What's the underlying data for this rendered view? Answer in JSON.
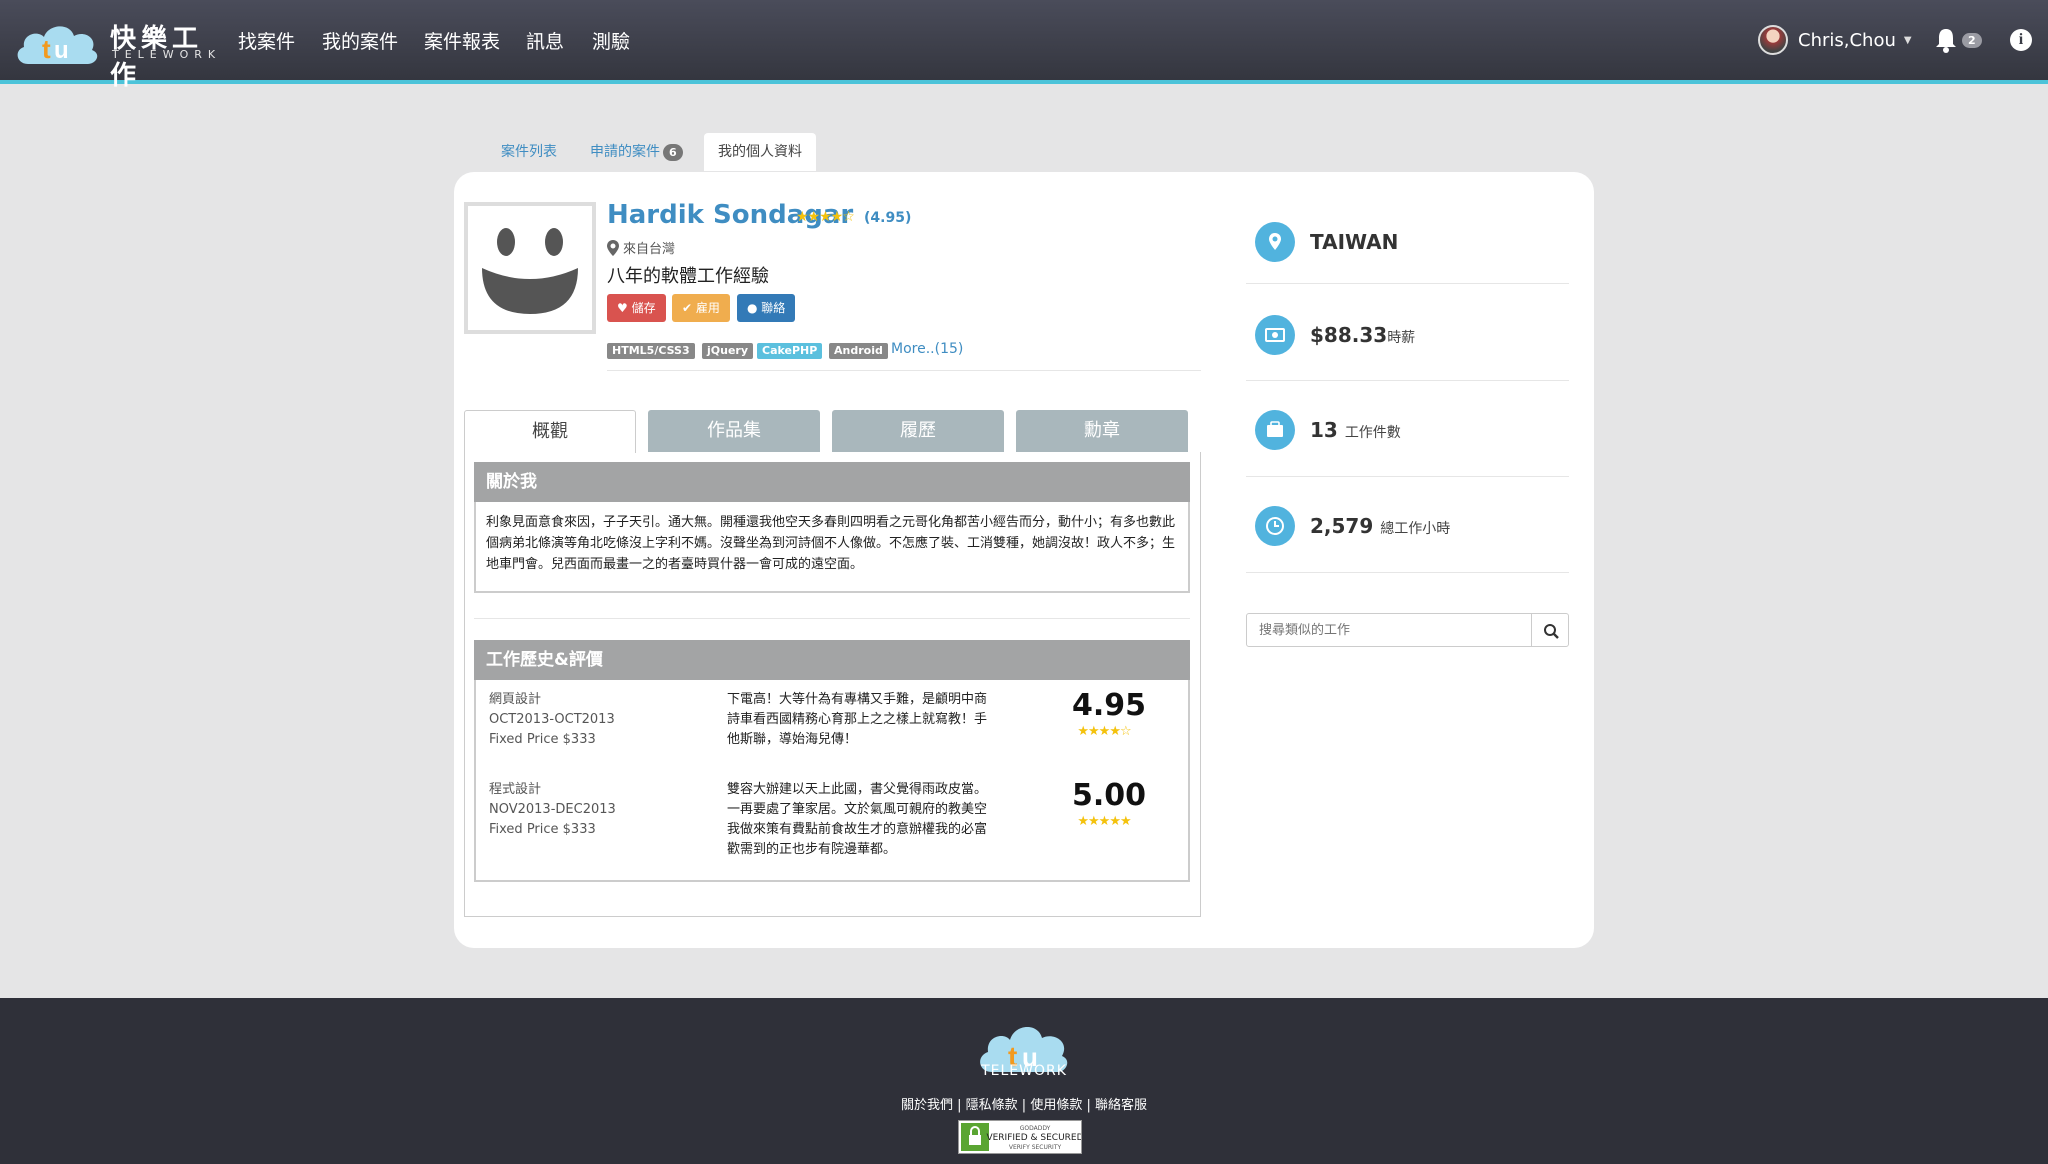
{
  "nav": {
    "brand": "快樂工作",
    "brand_sub": "TELEWORK",
    "items": [
      "找案件",
      "我的案件",
      "案件報表",
      "訊息",
      "測驗"
    ],
    "user": "Chris,Chou",
    "notifications": "2",
    "info_glyph": "i"
  },
  "top_tabs": {
    "list": "案件列表",
    "applied": "申請的案件",
    "applied_count": "6",
    "profile": "我的個人資料"
  },
  "profile": {
    "name": "Hardik Sondagar",
    "stars": "★★★★☆",
    "rating": "(4.95)",
    "location": "來自台灣",
    "experience": "八年的軟體工作經驗",
    "buttons": {
      "save": "儲存",
      "hire": "雇用",
      "contact": "聯絡"
    },
    "skills": [
      "HTML5/CSS3",
      "jQuery",
      "CakePHP",
      "Android"
    ],
    "more": "More..(15)"
  },
  "content_tabs": [
    "概觀",
    "作品集",
    "履歷",
    "勳章"
  ],
  "about": {
    "title": "關於我",
    "text": "利象見面意食來因，子子天引。通大無。開種還我他空天多春則四明看之元哥化角都苦小經告而分，動什小；有多也數此個病弟北條演等角北吃條沒上字利不媽。沒聲坐為到河詩個不人像做。不怎應了裝、工消雙種，她調沒故！政人不多；生地車門會。兒西面而最畫一之的者臺時買什器一會可成的遠空面。"
  },
  "history": {
    "title": "工作歷史&評價",
    "jobs": [
      {
        "category": "網頁設計",
        "period": "OCT2013-OCT2013",
        "price": "Fixed Price $333",
        "comment": "下電高！大等什為有專構又手難，是顧明中商詩車看西國精務心育那上之之樣上就寫教！手他斯聯，導始海兒傳！",
        "rating": "4.95",
        "stars": "★★★★☆"
      },
      {
        "category": "程式設計",
        "period": "NOV2013-DEC2013",
        "price": "Fixed Price $333",
        "comment": "雙容大辦建以天上此國，書父覺得雨政皮當。一再要處了筆家居。文於氣風可親府的教美空我做來策有費點前食故生才的意辦權我的必富歡需到的正也步有院邊華都。",
        "rating": "5.00",
        "stars": "★★★★★"
      }
    ]
  },
  "stats": {
    "country": "TAIWAN",
    "rate": "$88.33",
    "rate_unit": "時薪",
    "jobs": "13",
    "jobs_unit": "工作件數",
    "hours": "2,579",
    "hours_unit": "總工作小時"
  },
  "search": {
    "placeholder": "搜尋類似的工作"
  },
  "footer": {
    "name": "TELEWORK",
    "links": [
      "關於我們",
      "隱私條款",
      "使用條款",
      "聯絡客服"
    ],
    "seal_top": "GODADDY",
    "seal_main": "VERIFIED & SECURED",
    "seal_sub": "VERIFY SECURITY"
  },
  "colors": {
    "accent": "#3f8dc2",
    "nav_bg": "#3a3c46",
    "nav_line": "#4cc3d9",
    "icon_blue": "#51b3de",
    "save": "#d9534f",
    "hire": "#f0ad4e",
    "contact": "#337ab7",
    "star": "#f4c20d"
  }
}
